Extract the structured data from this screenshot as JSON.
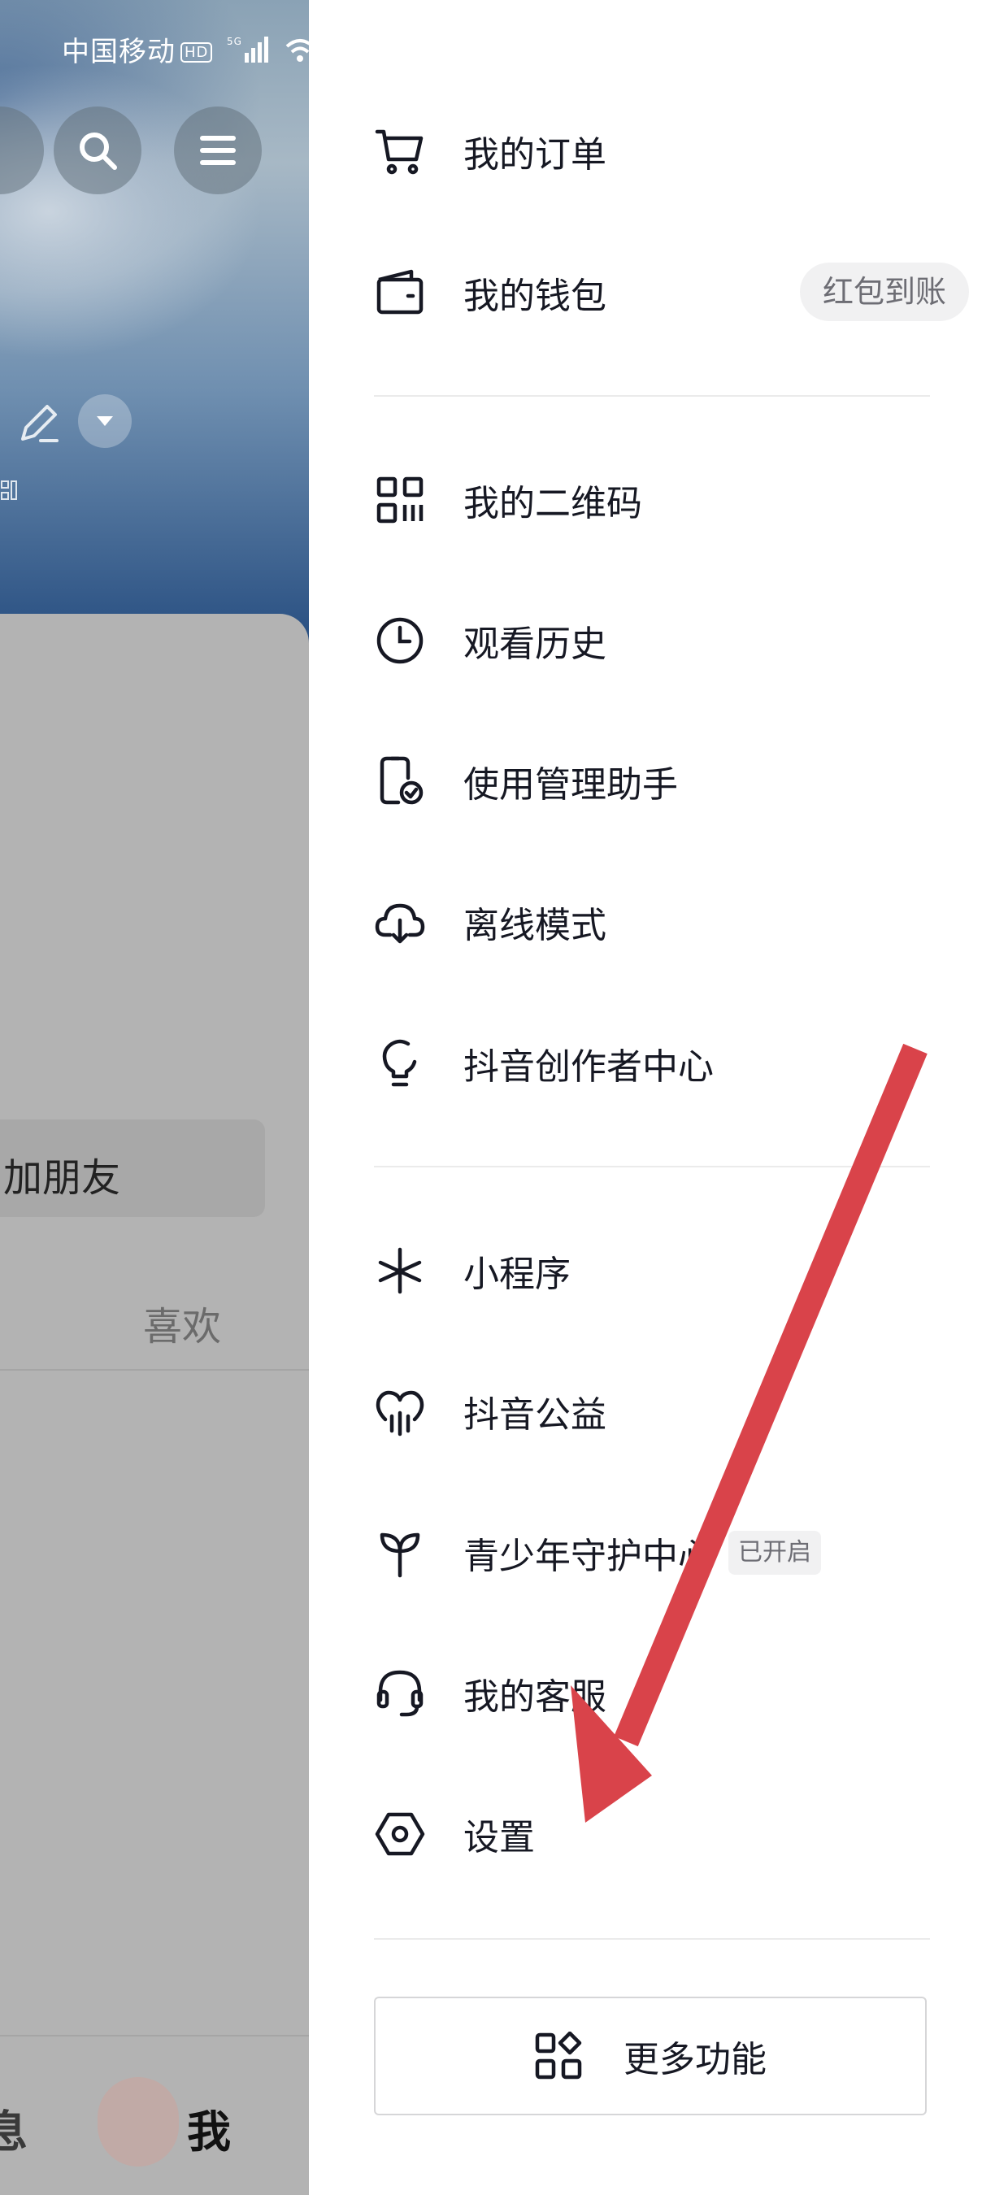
{
  "status_bar": {
    "carrier": "中国移动",
    "hd": "HD",
    "network": "5G"
  },
  "background": {
    "add_friend_label": "加朋友",
    "like_tab_label": "喜欢",
    "bottom_tabs": {
      "messages": "息",
      "me": "我"
    }
  },
  "drawer": {
    "orders": {
      "label": "我的订单",
      "icon": "cart-icon"
    },
    "wallet": {
      "label": "我的钱包",
      "icon": "wallet-icon",
      "badge": "红包到账"
    },
    "qrcode": {
      "label": "我的二维码",
      "icon": "qrcode-icon"
    },
    "history": {
      "label": "观看历史",
      "icon": "clock-icon"
    },
    "usage_assistant": {
      "label": "使用管理助手",
      "icon": "phone-check-icon"
    },
    "offline_mode": {
      "label": "离线模式",
      "icon": "cloud-download-icon"
    },
    "creator_center": {
      "label": "抖音创作者中心",
      "icon": "lightbulb-icon"
    },
    "mini_programs": {
      "label": "小程序",
      "icon": "asterisk-icon"
    },
    "charity": {
      "label": "抖音公益",
      "icon": "heart-rain-icon"
    },
    "youth_protection": {
      "label": "青少年守护中心",
      "icon": "sprout-icon",
      "badge": "已开启"
    },
    "customer_service": {
      "label": "我的客服",
      "icon": "headset-icon"
    },
    "settings": {
      "label": "设置",
      "icon": "hexagon-settings-icon"
    },
    "more_functions": {
      "label": "更多功能",
      "icon": "grid-icon"
    }
  },
  "colors": {
    "text": "#161823",
    "badge_bg": "#f1f1f2",
    "arrow": "#d9434a",
    "overlay": "#b4b4b4"
  }
}
